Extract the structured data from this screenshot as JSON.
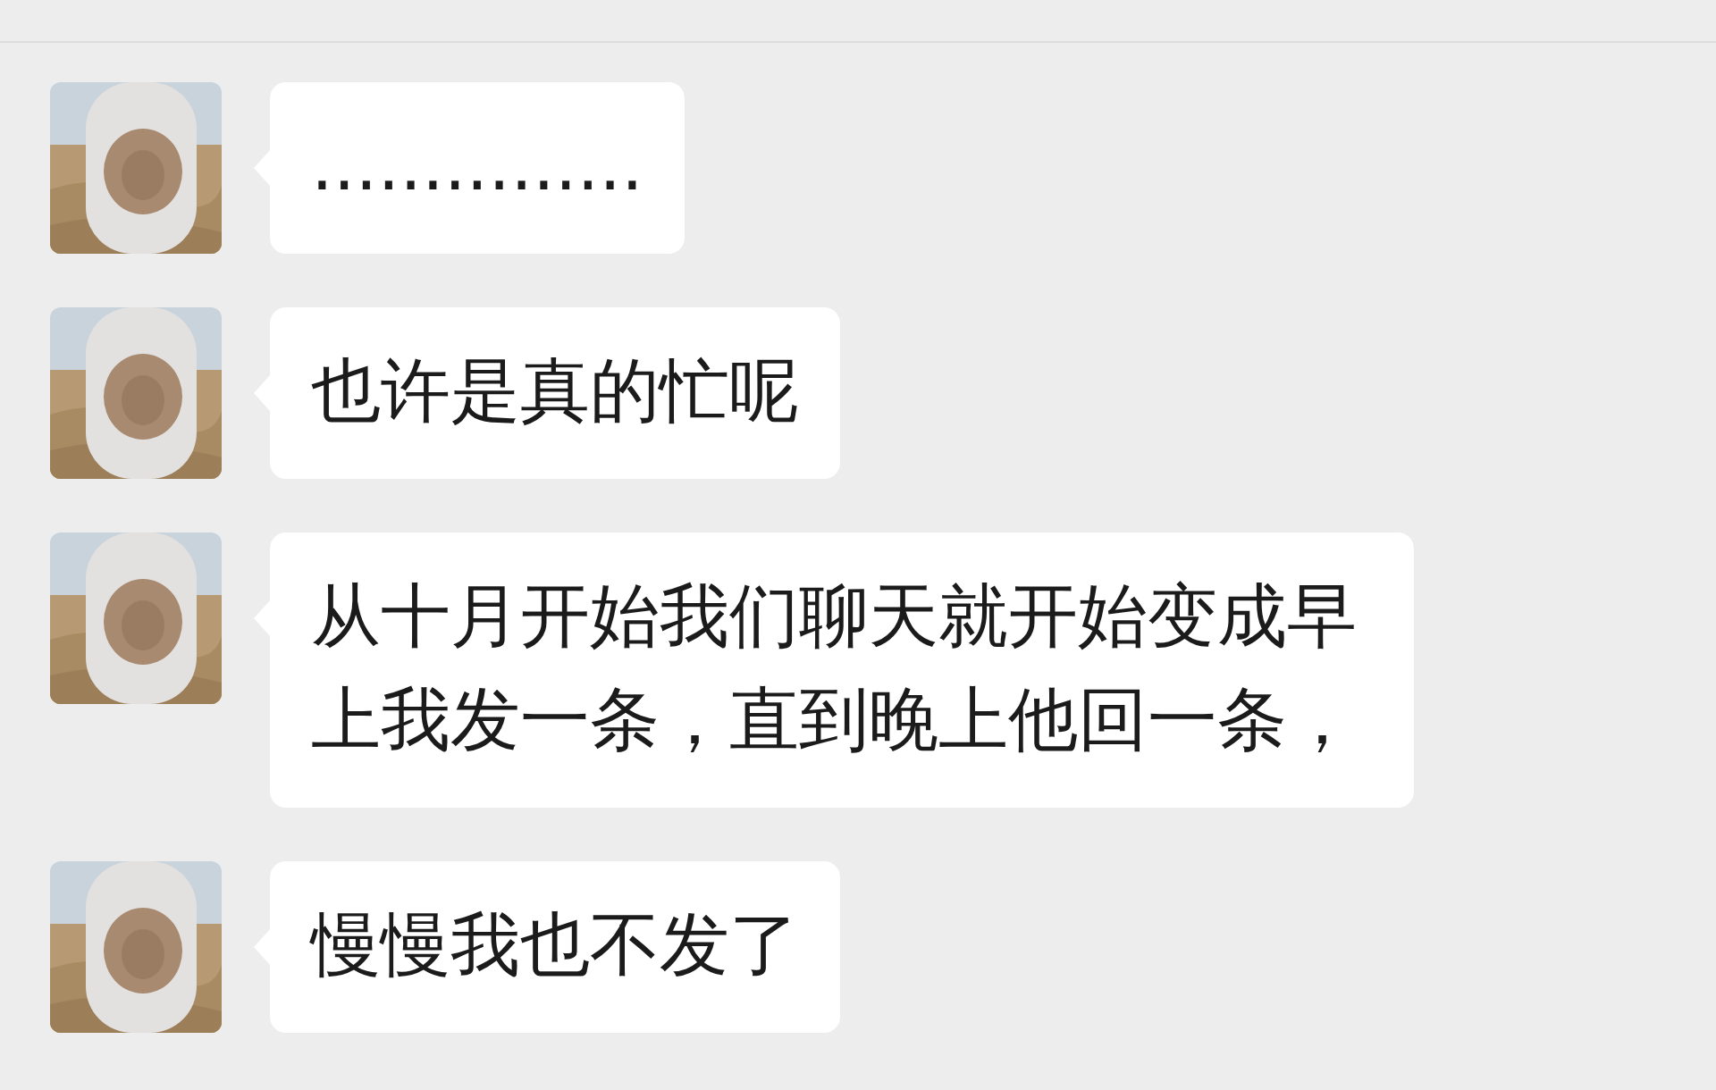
{
  "messages": [
    {
      "text": "..............."
    },
    {
      "text": "也许是真的忙呢"
    },
    {
      "text": "从十月开始我们聊天就开始变成早上我发一条，直到晚上他回一条，"
    },
    {
      "text": "慢慢我也不发了"
    }
  ]
}
